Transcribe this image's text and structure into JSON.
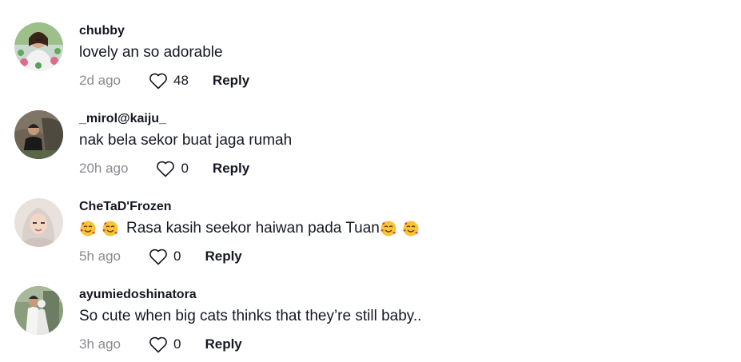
{
  "comments": [
    {
      "username": "chubby",
      "text": "lovely an so adorable",
      "time": "2d ago",
      "likes": "48",
      "reply_label": "Reply",
      "avatar_icon": "avatar-woman-flowers"
    },
    {
      "username": "_mirol@kaiju_",
      "text": "nak bela sekor buat jaga rumah",
      "time": "20h ago",
      "likes": "0",
      "reply_label": "Reply",
      "avatar_icon": "avatar-man-rocks"
    },
    {
      "username": "CheTaD'Frozen",
      "text_prefix_emoji": [
        "smiling-face-with-hearts",
        "smiling-face-with-hearts"
      ],
      "text": "Rasa kasih seekor haiwan pada Tuan",
      "text_suffix_emoji": [
        "smiling-face-with-hearts",
        "smiling-face-with-hearts"
      ],
      "time": "5h ago",
      "likes": "0",
      "reply_label": "Reply",
      "avatar_icon": "avatar-woman-hijab"
    },
    {
      "username": "ayumiedoshinatora",
      "text": "So cute when big cats thinks that they’re still baby..",
      "time": "3h ago",
      "likes": "0",
      "reply_label": "Reply",
      "avatar_icon": "avatar-couple-wedding"
    }
  ],
  "colors": {
    "text_primary": "#161823",
    "text_secondary": "#8a8b91",
    "background": "#ffffff"
  },
  "icons": {
    "like": "heart-outline-icon",
    "emoji": "smiling-face-with-hearts"
  }
}
